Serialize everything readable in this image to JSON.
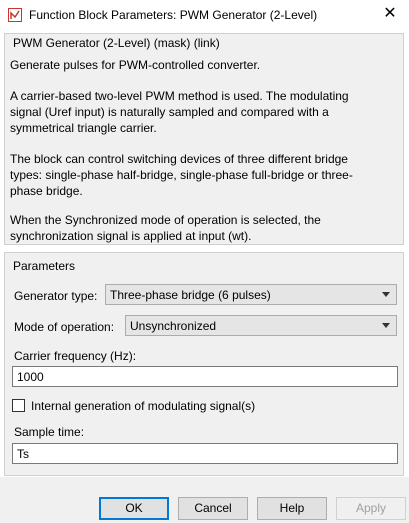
{
  "window": {
    "title": "Function Block Parameters: PWM Generator (2-Level)",
    "close_glyph": "✕",
    "icon": "simulink-block-icon"
  },
  "mask": {
    "title": "PWM Generator (2-Level) (mask) (link)",
    "description_lines": [
      "Generate pulses for PWM-controlled converter.",
      "A carrier-based two-level PWM method is used. The modulating",
      "signal (Uref input) is naturally sampled and compared with a",
      "symmetrical triangle carrier.",
      "The block can control switching devices of three different bridge",
      "types: single-phase half-bridge, single-phase full-bridge or three-",
      "phase bridge.",
      "When the Synchronized mode of operation is selected, the",
      "synchronization signal is applied at input (wt)."
    ]
  },
  "parameters": {
    "title": "Parameters",
    "generator_type": {
      "label": "Generator type:",
      "value": "Three-phase bridge (6 pulses)"
    },
    "mode_of_operation": {
      "label": "Mode of operation:",
      "value": "Unsynchronized"
    },
    "carrier_frequency": {
      "label": "Carrier frequency (Hz):",
      "value": "1000"
    },
    "internal_generation": {
      "label": "Internal generation of modulating signal(s)",
      "checked": false
    },
    "sample_time": {
      "label": "Sample time:",
      "value": "Ts"
    }
  },
  "buttons": {
    "ok": "OK",
    "cancel": "Cancel",
    "help": "Help",
    "apply": "Apply"
  },
  "colors": {
    "panel_bg": "#f0f0f0",
    "default_button_border": "#0078d7",
    "icon_red": "#c8372d"
  }
}
